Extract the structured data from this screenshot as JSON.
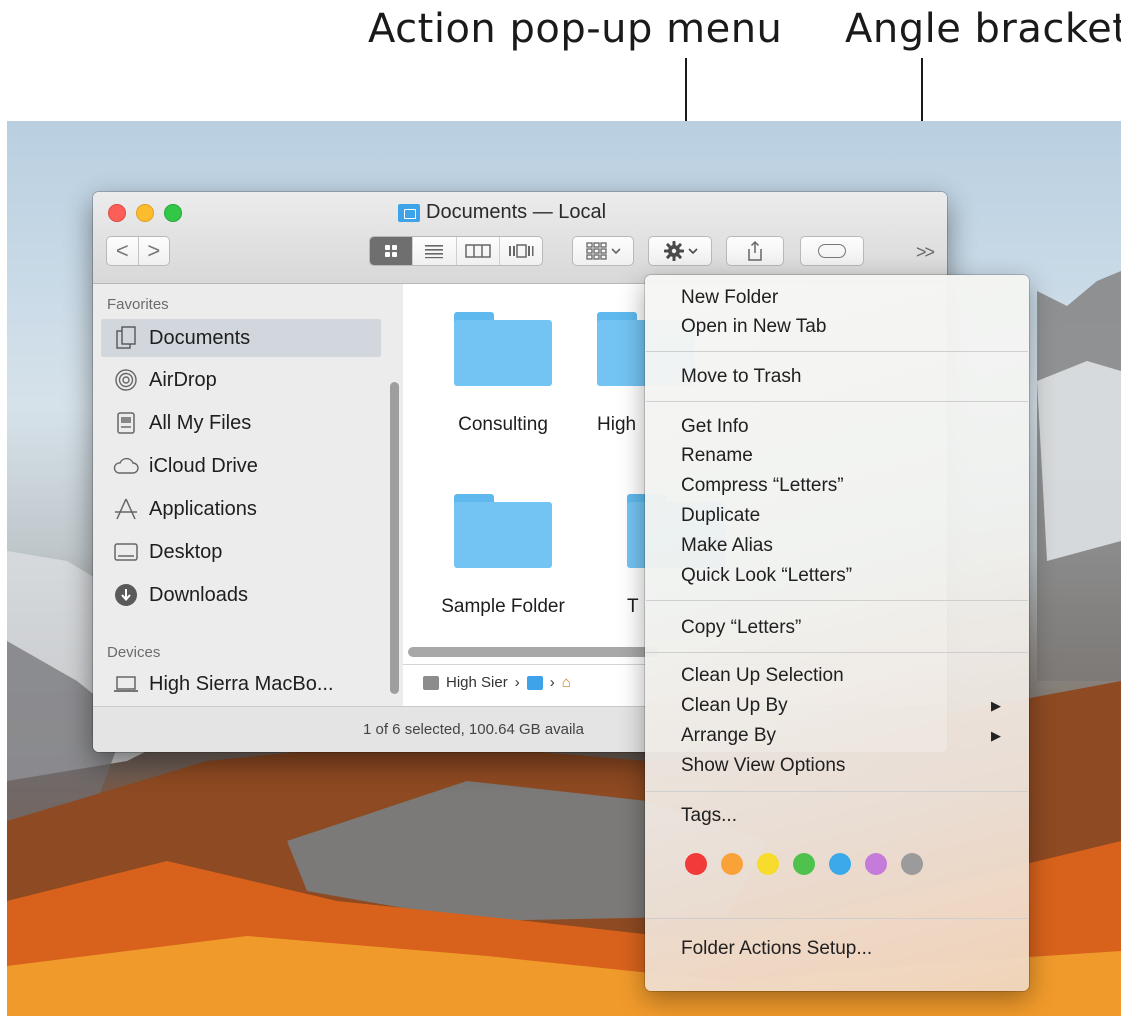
{
  "callouts": {
    "action": "Action pop-up menu",
    "angle": "Angle brackets"
  },
  "window": {
    "title": "Documents — Local",
    "back_label": "<",
    "forward_label": ">",
    "more_label": ">>",
    "status": "1 of 6 selected, 100.64 GB availa"
  },
  "sidebar": {
    "favorites_label": "Favorites",
    "favorites": [
      {
        "label": "Documents",
        "icon": "documents-icon"
      },
      {
        "label": "AirDrop",
        "icon": "airdrop-icon"
      },
      {
        "label": "All My Files",
        "icon": "all-files-icon"
      },
      {
        "label": "iCloud Drive",
        "icon": "cloud-icon"
      },
      {
        "label": "Applications",
        "icon": "applications-icon"
      },
      {
        "label": "Desktop",
        "icon": "desktop-icon"
      },
      {
        "label": "Downloads",
        "icon": "downloads-icon"
      }
    ],
    "devices_label": "Devices",
    "devices": [
      {
        "label": "High Sierra MacBo...",
        "icon": "laptop-icon"
      }
    ]
  },
  "files": [
    {
      "name": "Consulting"
    },
    {
      "name": "High"
    },
    {
      "name": "Sample Folder"
    },
    {
      "name": "T"
    }
  ],
  "pathbar": {
    "drive_label": "High Sier"
  },
  "menu": {
    "items": [
      "New Folder",
      "Open in New Tab",
      "Move to Trash",
      "Get Info",
      "Rename",
      "Compress “Letters”",
      "Duplicate",
      "Make Alias",
      "Quick Look “Letters”",
      "Copy “Letters”",
      "Clean Up Selection",
      "Clean Up By",
      "Arrange By",
      "Show View Options",
      "Tags...",
      "Folder Actions Setup..."
    ],
    "tag_colors": [
      "#f23a3a",
      "#f9a23a",
      "#f7dc2e",
      "#4fc24d",
      "#3ba9ea",
      "#c57bd9",
      "#9b9b9b"
    ]
  }
}
